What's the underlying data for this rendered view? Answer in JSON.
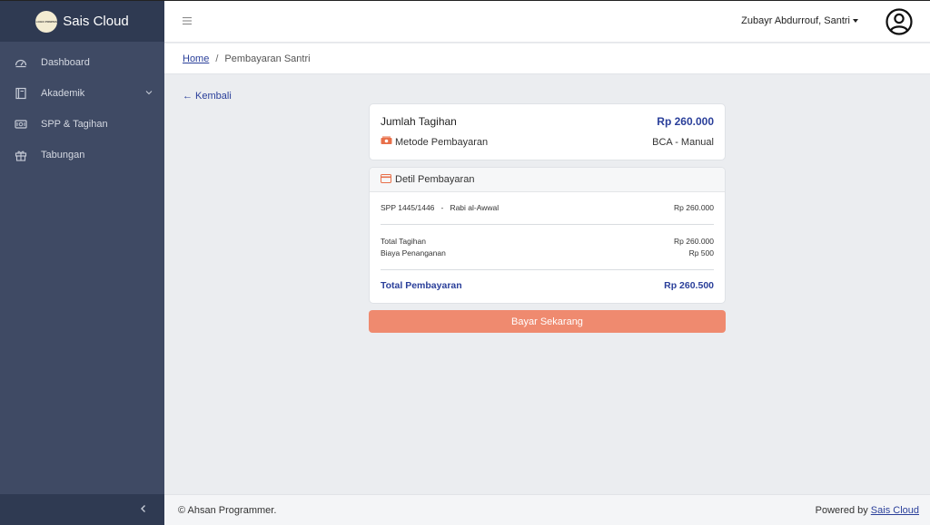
{
  "brand": {
    "logo_text": "LOGO PONPES",
    "name": "Sais Cloud"
  },
  "sidebar": {
    "items": [
      {
        "label": "Dashboard",
        "icon": "dashboard-icon"
      },
      {
        "label": "Akademik",
        "icon": "book-icon",
        "expandable": true
      },
      {
        "label": "SPP & Tagihan",
        "icon": "bill-icon"
      },
      {
        "label": "Tabungan",
        "icon": "gift-icon"
      }
    ],
    "collapse_icon": "chevron-left-icon"
  },
  "topbar": {
    "menu_icon": "hamburger-icon",
    "user_name": "Zubayr Abdurrouf, Santri",
    "avatar_icon": "user-avatar-icon"
  },
  "breadcrumb": {
    "home": "Home",
    "separator": "/",
    "current": "Pembayaran Santri"
  },
  "main": {
    "back_label": "← Kembali",
    "summary": {
      "title": "Jumlah Tagihan",
      "amount": "Rp 260.000",
      "method_label": "Metode Pembayaran",
      "method_value": "BCA - Manual"
    },
    "detail": {
      "title": "Detil Pembayaran",
      "item_name": "SPP 1445/1446",
      "item_dash": "-",
      "item_month": "Rabi al-Awwal",
      "item_amount": "Rp 260.000",
      "total_label": "Total Tagihan",
      "total_value": "Rp 260.000",
      "fee_label": "Biaya Penanganan",
      "fee_value": "Rp 500",
      "grand_label": "Total Pembayaran",
      "grand_value": "Rp 260.500"
    },
    "pay_button": "Bayar Sekarang"
  },
  "footer": {
    "copyright": "© Ahsan Programmer.",
    "powered_prefix": "Powered by",
    "powered_link": "Sais Cloud"
  },
  "colors": {
    "sidebar": "#3f4a64",
    "sidebar_dark": "#2f3a52",
    "accent_blue": "#2a3f9a",
    "button": "#ef8a6f",
    "icon_orange": "#e8704a"
  }
}
